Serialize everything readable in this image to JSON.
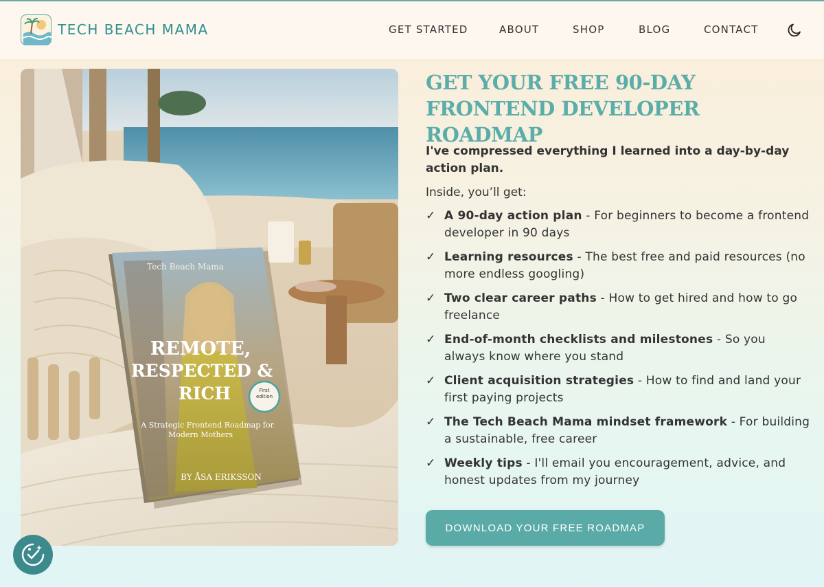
{
  "brand": {
    "name": "TECH BEACH MAMA"
  },
  "nav": {
    "items": [
      {
        "label": "GET STARTED"
      },
      {
        "label": "ABOUT"
      },
      {
        "label": "SHOP"
      },
      {
        "label": "BLOG"
      },
      {
        "label": "CONTACT"
      }
    ],
    "theme_toggle_icon": "moon-icon"
  },
  "hero": {
    "image": {
      "book_author_top": "Tech Beach Mama",
      "book_title_line1": "REMOTE,",
      "book_title_line2": "RESPECTED &",
      "book_title_line3": "RICH",
      "book_edition": "First edition",
      "book_subtitle_line1": "A Strategic Frontend Roadmap for",
      "book_subtitle_line2": "Modern Mothers",
      "book_byline": "BY ÅSA ERIKSSON"
    },
    "heading": "GET YOUR FREE 90-DAY FRONTEND DEVELOPER ROADMAP",
    "intro": "I've compressed everything I learned into a day-by-day action plan.",
    "inside_label": "Inside, you’ll get:",
    "benefits": [
      {
        "title": "A 90-day action plan",
        "desc": " - For beginners to become a frontend developer in 90 days"
      },
      {
        "title": "Learning resources",
        "desc": " - The best free and paid resources (no more endless googling)"
      },
      {
        "title": "Two clear career paths",
        "desc": " - How to get hired and how to go freelance"
      },
      {
        "title": "End-of-month checklists and milestones",
        "desc": " - So you always know where you stand"
      },
      {
        "title": "Client acquisition strategies",
        "desc": " - How to find and land your first paying projects"
      },
      {
        "title": "The Tech Beach Mama mindset framework",
        "desc": " - For building a sustainable, free career"
      },
      {
        "title": "Weekly tips",
        "desc": " - I'll email you encouragement, advice, and honest updates from my journey"
      }
    ],
    "check_glyph": "✓",
    "cta_label": "DOWNLOAD YOUR FREE ROADMAP"
  },
  "colors": {
    "accent": "#5aaba7",
    "heading": "#5aada9",
    "brand": "#2f8f8c"
  },
  "accessibility": {
    "icon": "accessibility-icon"
  }
}
